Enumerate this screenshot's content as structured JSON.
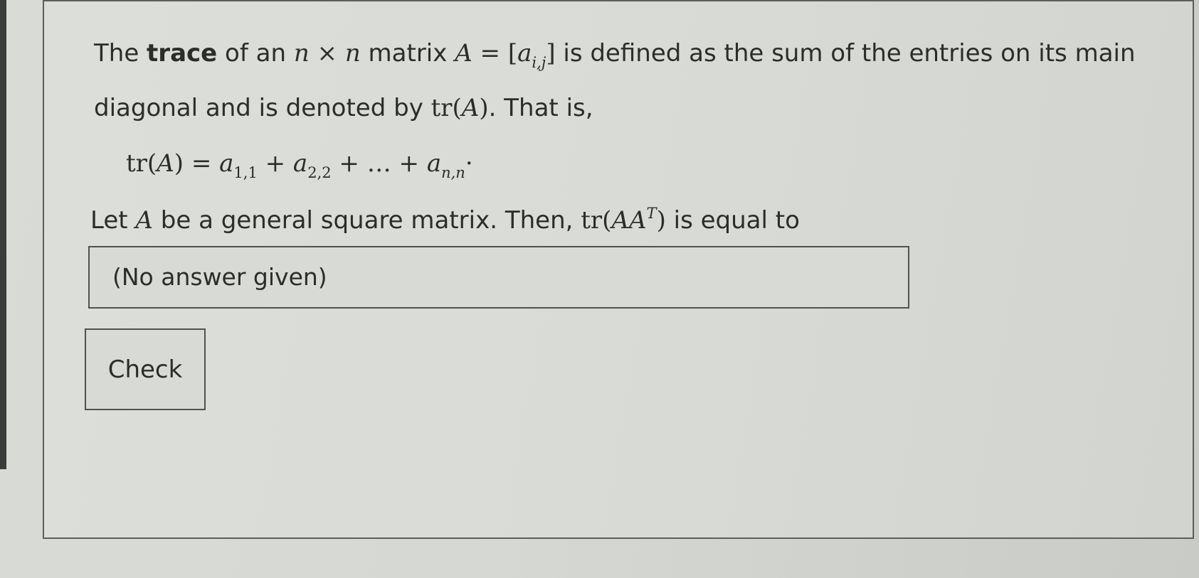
{
  "question": {
    "line1": {
      "t1": "The ",
      "bold": "trace",
      "t2": " of an ",
      "n1": "n",
      "times": " × ",
      "n2": "n",
      "t3": " matrix ",
      "A": "A",
      "eq": " = [",
      "a": "a",
      "sub": "i,j",
      "close": "]",
      "t4": " is defined as the sum of the entries on its main"
    },
    "line2": {
      "t1": "diagonal and is denoted by ",
      "tr": "tr(",
      "A": "A",
      "close": ")",
      "t2": ". That is,"
    },
    "formula": {
      "tr": "tr(",
      "A": "A",
      "eq": ") = ",
      "a1": "a",
      "s1": "1,1",
      "plus1": " + ",
      "a2": "a",
      "s2": "2,2",
      "plus2": " + … + ",
      "an": "a",
      "sn": "n,n",
      "end": "·"
    },
    "line4": {
      "t1": "Let ",
      "A": "A",
      "t2": " be a general square matrix. Then, ",
      "tr": "tr(",
      "AA": "AA",
      "T": "T",
      "close": ")",
      "t3": " is equal to"
    }
  },
  "answer": {
    "value": "(No answer given)"
  },
  "check_button": {
    "label": "Check"
  }
}
